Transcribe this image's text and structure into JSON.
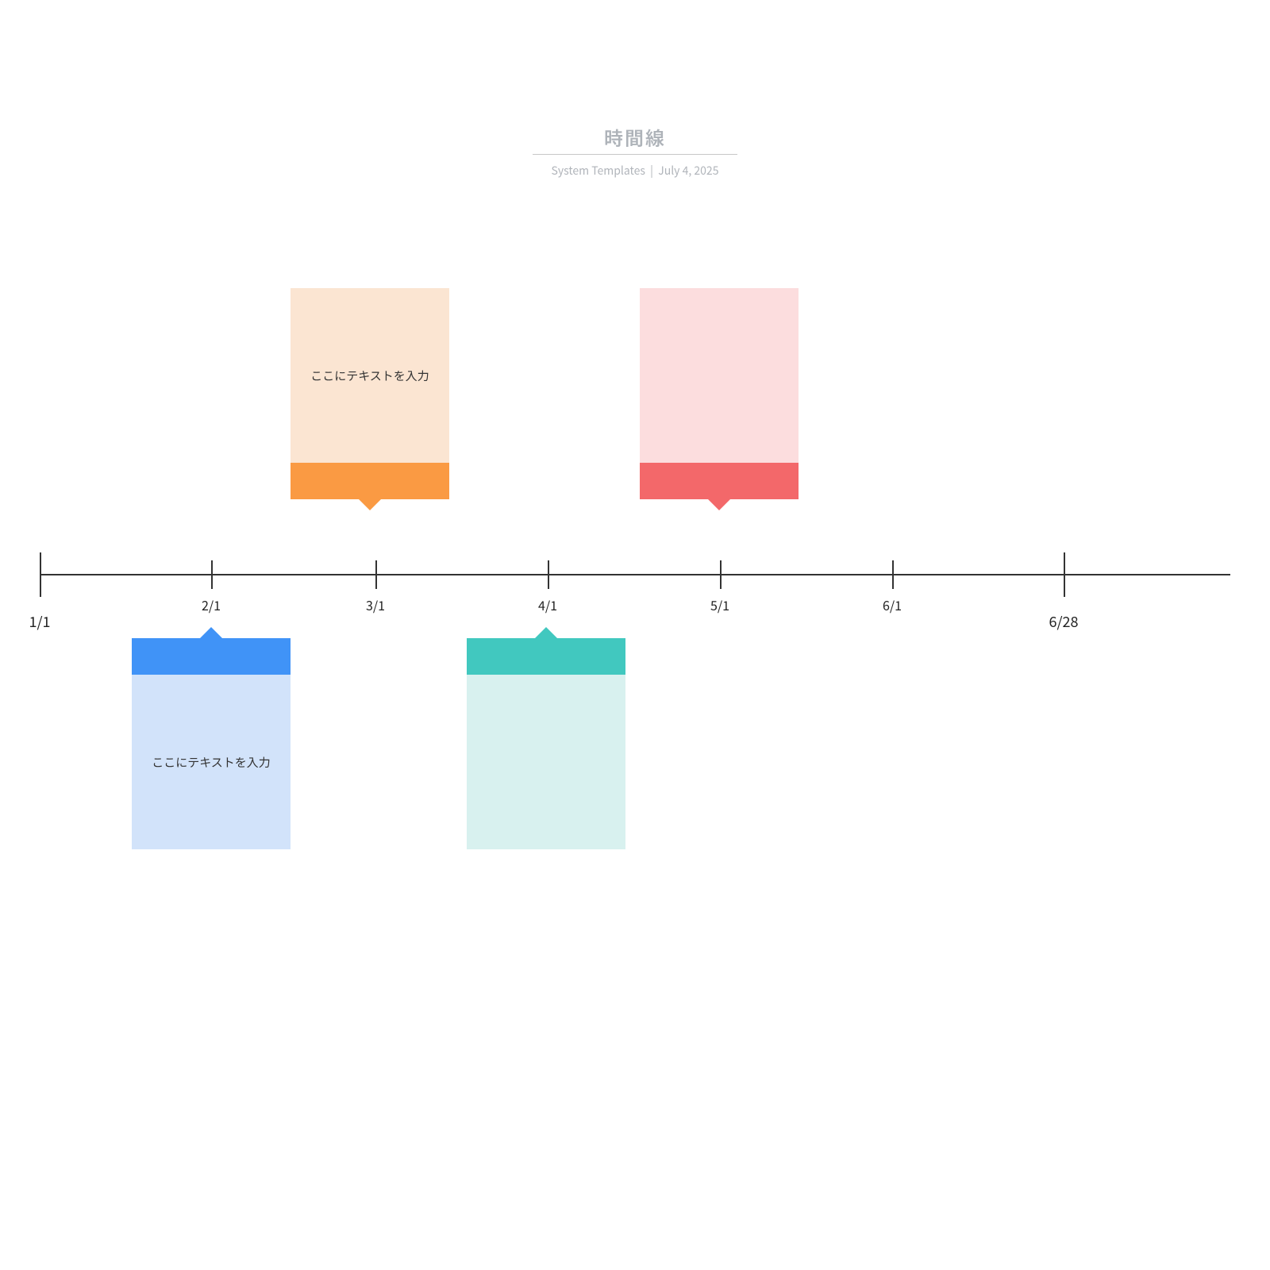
{
  "header": {
    "title": "時間線",
    "subtitle_source": "System Templates",
    "subtitle_date": "July 4, 2025"
  },
  "timeline": {
    "start_label": "1/1",
    "end_label": "6/28",
    "ticks": [
      {
        "label": "2/1",
        "pos": 266
      },
      {
        "label": "3/1",
        "pos": 473
      },
      {
        "label": "4/1",
        "pos": 690
      },
      {
        "label": "5/1",
        "pos": 907
      },
      {
        "label": "6/1",
        "pos": 1124
      }
    ]
  },
  "cards": {
    "orange": {
      "text": "ここにテキストを入力"
    },
    "pink": {
      "text": ""
    },
    "blue": {
      "text": "ここにテキストを入力"
    },
    "teal": {
      "text": ""
    }
  }
}
